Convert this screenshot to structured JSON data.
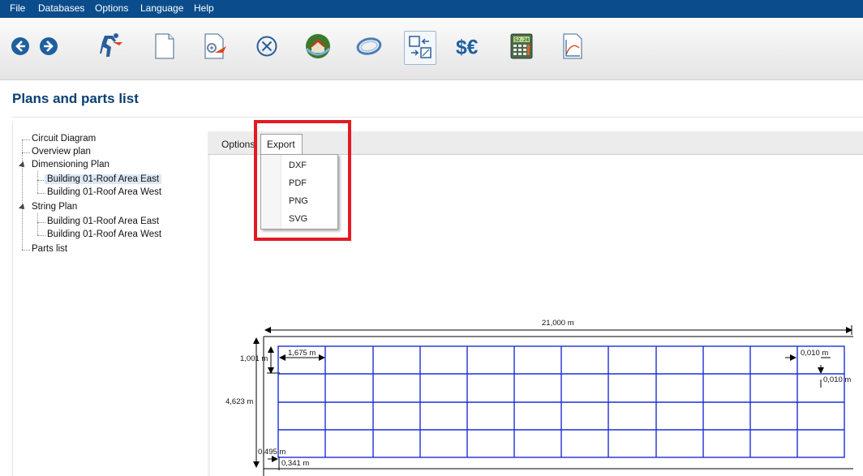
{
  "menu": [
    "File",
    "Databases",
    "Options",
    "Language",
    "Help"
  ],
  "toolbar_icons": [
    "back-arrow-icon",
    "forward-arrow-icon",
    "run-icon",
    "new-document-icon",
    "settings-document-icon",
    "cancel-circle-icon",
    "3d-house-icon",
    "ring-icon",
    "plans-exchange-icon",
    "currency-icon",
    "calculator-icon",
    "graph-document-icon"
  ],
  "calculator_display": "52.24",
  "page": {
    "title": "Plans and parts list"
  },
  "tree": {
    "circuit_diagram": "Circuit Diagram",
    "overview_plan": "Overview plan",
    "dimensioning_plan": "Dimensioning Plan",
    "dim_east": "Building 01-Roof Area East",
    "dim_west": "Building 01-Roof Area West",
    "string_plan": "String Plan",
    "string_east": "Building 01-Roof Area East",
    "string_west": "Building 01-Roof Area West",
    "parts_list": "Parts list"
  },
  "tabs": {
    "options": "Options",
    "export": "Export"
  },
  "export_menu": [
    "DXF",
    "PDF",
    "PNG",
    "SVG"
  ],
  "drawing": {
    "total_width": "21,000 m",
    "row_height": "1,001 m",
    "total_height": "4,623 m",
    "module_width": "1,675 m",
    "gap_horizontal": "0,010 m",
    "gap_vertical": "0,010 m",
    "bottom_offset": "0,495 m",
    "left_offset": "0,341 m"
  },
  "colors": {
    "menubar": "#0b4d8c",
    "title": "#0b3f72",
    "grid": "#1f2fd6",
    "highlight": "#e21b23"
  }
}
